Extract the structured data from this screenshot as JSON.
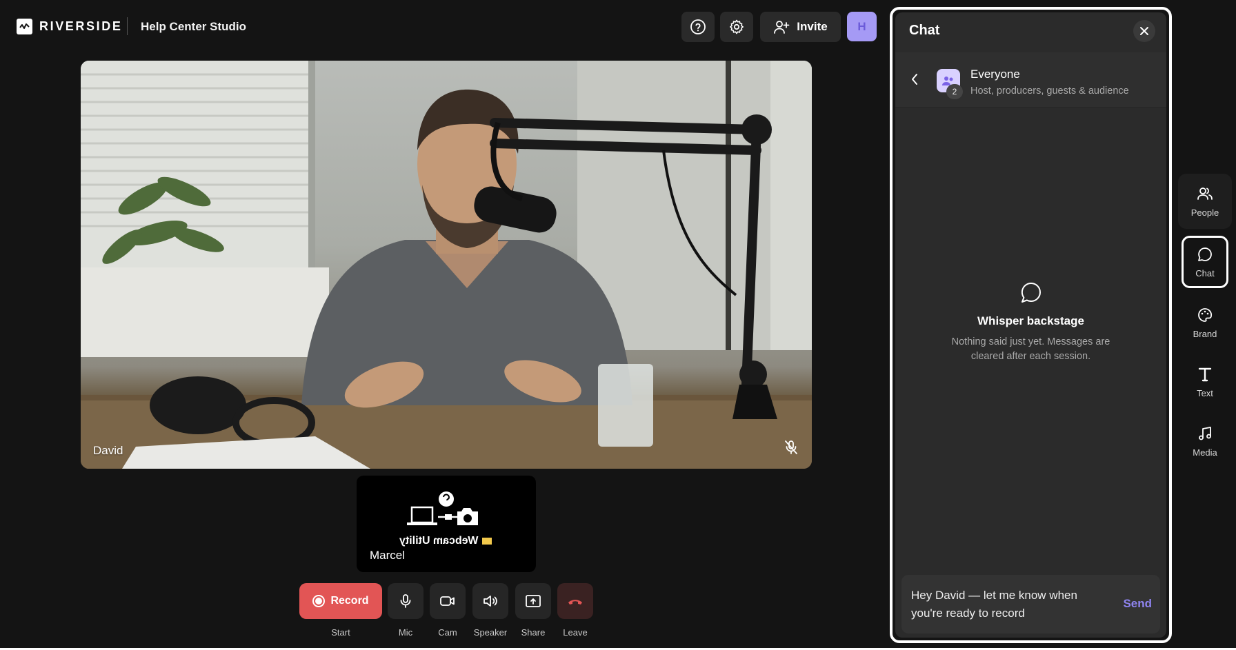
{
  "header": {
    "brand": "RIVERSIDE",
    "studio_name": "Help Center Studio",
    "invite_label": "Invite",
    "avatar_initial": "H"
  },
  "stage": {
    "speaker_name": "David",
    "guest": {
      "name": "Marcel",
      "mirrored_caption": "Webcam Utility"
    }
  },
  "controls": [
    {
      "key": "record",
      "button_label": "Record",
      "label": "Start"
    },
    {
      "key": "mic",
      "label": "Mic"
    },
    {
      "key": "cam",
      "label": "Cam"
    },
    {
      "key": "speaker",
      "label": "Speaker"
    },
    {
      "key": "share",
      "label": "Share"
    },
    {
      "key": "leave",
      "label": "Leave"
    }
  ],
  "chat": {
    "title": "Chat",
    "channel_name": "Everyone",
    "channel_count": "2",
    "channel_description": "Host, producers, guests & audience",
    "empty_title": "Whisper backstage",
    "empty_text": "Nothing said just yet. Messages are cleared after each session.",
    "composer_value": "Hey David — let me know when you're ready to record",
    "send_label": "Send"
  },
  "rail": [
    {
      "key": "people",
      "label": "People"
    },
    {
      "key": "chat",
      "label": "Chat",
      "active": true
    },
    {
      "key": "brand",
      "label": "Brand"
    },
    {
      "key": "text",
      "label": "Text"
    },
    {
      "key": "media",
      "label": "Media"
    }
  ],
  "colors": {
    "record": "#e25555",
    "send": "#8f84f0",
    "avatar": "#a59af5"
  }
}
